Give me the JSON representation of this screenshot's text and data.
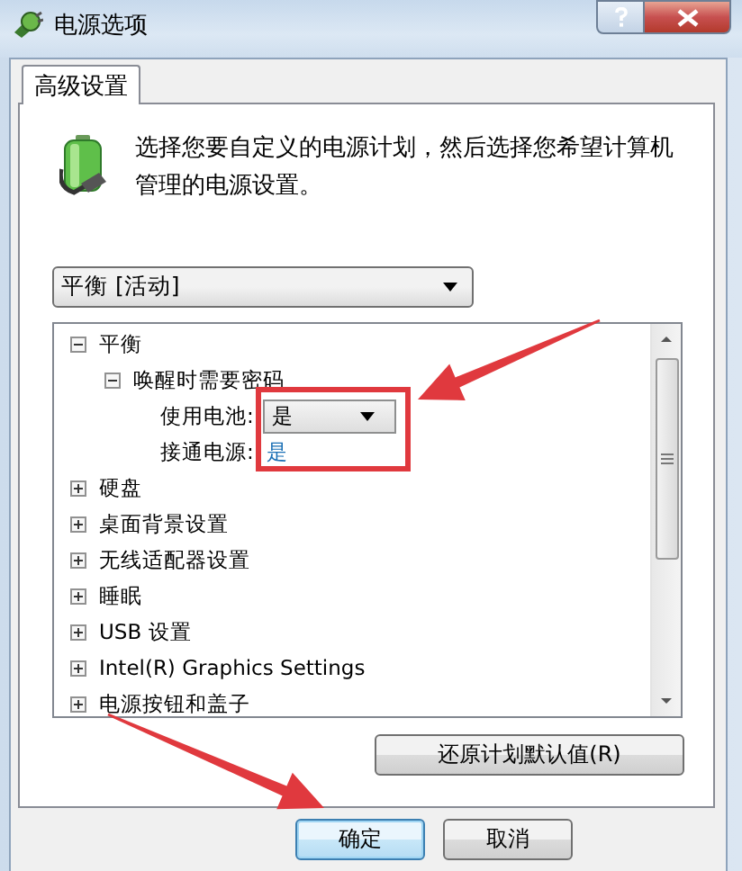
{
  "window": {
    "title": "电源选项"
  },
  "tabs": [
    {
      "label": "高级设置",
      "selected": true
    }
  ],
  "description": "选择您要自定义的电源计划，然后选择您希望计算机管理的电源设置。",
  "plan_select": {
    "value": "平衡 [活动]"
  },
  "tree": [
    {
      "label": "平衡",
      "expanded": true,
      "children": [
        {
          "label": "唤醒时需要密码",
          "expanded": true,
          "children": [
            {
              "kind": "setting",
              "label": "使用电池:",
              "value": "是",
              "editing": true
            },
            {
              "kind": "setting",
              "label": "接通电源:",
              "value": "是",
              "editing": false
            }
          ]
        }
      ]
    },
    {
      "label": "硬盘",
      "expanded": false
    },
    {
      "label": "桌面背景设置",
      "expanded": false
    },
    {
      "label": "无线适配器设置",
      "expanded": false
    },
    {
      "label": "睡眠",
      "expanded": false
    },
    {
      "label": "USB 设置",
      "expanded": false
    },
    {
      "label": "Intel(R) Graphics Settings",
      "expanded": false
    },
    {
      "label": "电源按钮和盖子",
      "expanded": false
    }
  ],
  "restore_button": "还原计划默认值(R)",
  "buttons": [
    {
      "label": "确定",
      "default": true
    },
    {
      "label": "取消",
      "default": false
    }
  ],
  "annotations": [
    {
      "kind": "box"
    },
    {
      "kind": "arrow"
    },
    {
      "kind": "arrow"
    }
  ]
}
